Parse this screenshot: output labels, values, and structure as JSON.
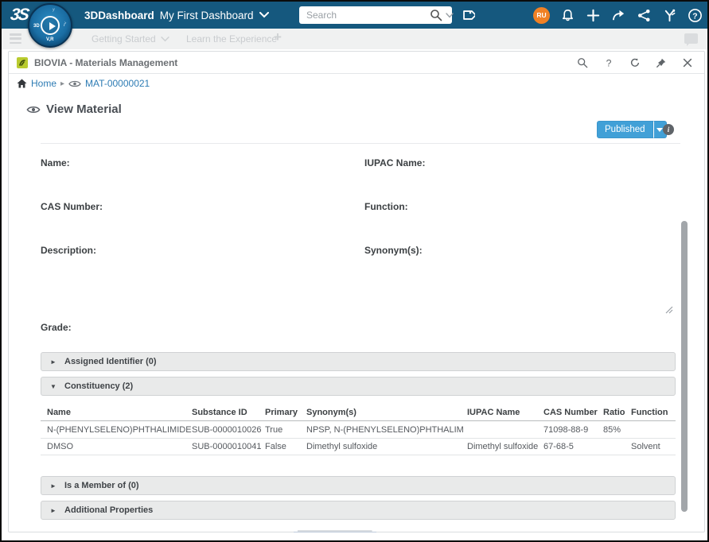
{
  "topbar": {
    "logo": "3S",
    "app_title": "3DDashboard",
    "dashboard_name": "My First Dashboard",
    "search_placeholder": "Search",
    "avatar_initials": "RU",
    "compass": {
      "left_label": "3D",
      "bottom_label": "V,R"
    }
  },
  "tabbar": {
    "tab1": "Getting Started",
    "tab2": "Learn the Experience",
    "add_tab": "+"
  },
  "icons": {
    "collapsed": "►",
    "expanded": "▼",
    "breadcrumb_sep": "▸",
    "plus": "+",
    "info": "i"
  },
  "widget": {
    "title": "BIOVIA - Materials Management",
    "breadcrumb": {
      "home": "Home",
      "current": "MAT-00000021"
    },
    "page_title": "View Material",
    "status_button": "Published",
    "fields": {
      "name": "Name:",
      "iupac": "IUPAC Name:",
      "cas": "CAS Number:",
      "function": "Function:",
      "description": "Description:",
      "synonyms": "Synonym(s):",
      "grade": "Grade:"
    },
    "sections": {
      "assigned": "Assigned Identifier (0)",
      "constituency": "Constituency (2)",
      "member": "Is a Member of (0)",
      "additional": "Additional Properties"
    },
    "constituency_table": {
      "headers": [
        "Name",
        "Substance ID",
        "Primary",
        "Synonym(s)",
        "IUPAC Name",
        "CAS Number",
        "Ratio",
        "Function"
      ],
      "rows": [
        [
          "N-(PHENYLSELENO)PHTHALIMIDE",
          "SUB-0000010026",
          "True",
          "NPSP, N-(PHENYLSELENO)PHTHALIM...",
          "",
          "71098-88-9",
          "85%",
          ""
        ],
        [
          "DMSO",
          "SUB-0000010041",
          "False",
          "Dimethyl sulfoxide",
          "Dimethyl sulfoxide",
          "67-68-5",
          "",
          "Solvent"
        ]
      ]
    }
  },
  "colors": {
    "topbar_blue": "#15587e",
    "accent_blue": "#41a0d7",
    "link_blue": "#2e7cb4",
    "avatar_orange": "#f08125",
    "biovia_green": "#b9cb2f",
    "section_gray": "#e9eaea"
  }
}
